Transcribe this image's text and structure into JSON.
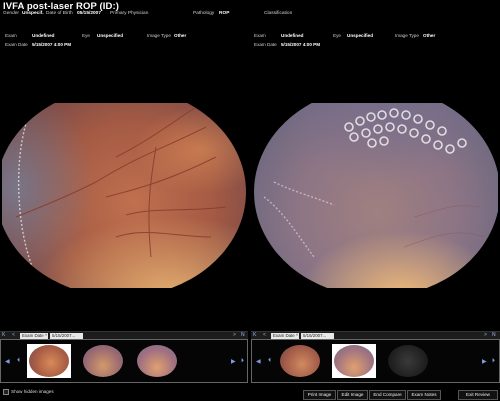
{
  "window": {
    "title": "IVFA post-laser ROP (ID:)"
  },
  "patient": {
    "gender_label": "Gender",
    "gender_value": "Unspecif.",
    "dob_label": "Date of Birth",
    "dob_value": "05/15/2007",
    "physician_label": "Primary Physician",
    "pathology_label": "Pathology",
    "pathology_value": "ROP",
    "classification_label": "Classification"
  },
  "left_panel": {
    "exam_label": "Exam",
    "exam_value": "Undefined",
    "eye_label": "Eye",
    "eye_value": "Unspecified",
    "image_type_label": "Image Type",
    "image_type_value": "Other",
    "exam_date_label": "Exam Date",
    "exam_date_value": "5/15/2007 4:00 PM",
    "strip": {
      "first": "K",
      "prev": "<",
      "next": ">",
      "last": "N",
      "exam_field": "Exam Date ^",
      "date_field": "5/15/2007..."
    }
  },
  "right_panel": {
    "exam_label": "Exam",
    "exam_value": "Undefined",
    "eye_label": "Eye",
    "eye_value": "Unspecified",
    "image_type_label": "Image Type",
    "image_type_value": "Other",
    "exam_date_label": "Exam Date",
    "exam_date_value": "5/15/2007 4:00 PM",
    "strip": {
      "first": "K",
      "prev": "<",
      "next": ">",
      "last": "N",
      "exam_field": "Exam Date ^",
      "date_field": "5/15/2007..."
    }
  },
  "footer": {
    "show_hidden_label": "Show hidden images",
    "buttons": [
      "Print Image",
      "Edit Image",
      "End Compare",
      "Exam Notes",
      "Exit Review"
    ]
  },
  "colors": {
    "accent_nav": "#7f9ce0",
    "background": "#000000"
  }
}
